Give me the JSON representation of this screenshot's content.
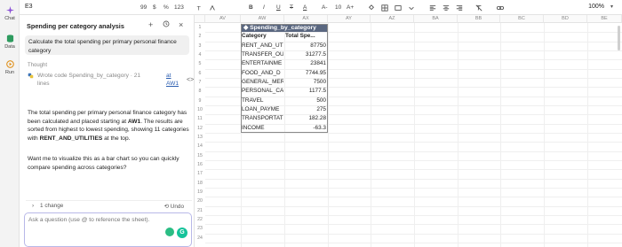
{
  "toolbar": {
    "cell_ref": "E3",
    "zoom": "100%",
    "font_size": "10",
    "decimals": "123",
    "percent": "%",
    "currency": "$",
    "quote": "99"
  },
  "rail": {
    "items": [
      {
        "label": "Chat"
      },
      {
        "label": "Data"
      },
      {
        "label": "Run"
      }
    ]
  },
  "panel": {
    "title": "Spending per category analysis",
    "user_message": "Calculate the total spending per primary personal finance category",
    "thought_label": "Thought",
    "tool_text": "Wrote code Spending_by_category · 21 lines",
    "tool_link": "at AW1",
    "answer_p1_a": "The total spending per primary personal finance category has been calculated and placed starting at ",
    "answer_p1_b": "AW1",
    "answer_p1_c": ". The results are sorted from highest to lowest spending, showing 11 categories with ",
    "answer_p1_d": "RENT_AND_UTILITIES",
    "answer_p1_e": " at the top.",
    "answer_p2": "Want me to visualize this as a bar chart so you can quickly compare spending across categories?",
    "change_label": "1 change",
    "undo_label": "Undo",
    "input_placeholder": "Ask a question (use @ to reference the sheet)."
  },
  "grid": {
    "columns": [
      "AV",
      "AW",
      "AX",
      "AY",
      "AZ",
      "BA",
      "BB",
      "BC",
      "BD",
      "BE"
    ],
    "rows": [
      "1",
      "2",
      "3",
      "4",
      "5",
      "6",
      "7",
      "8",
      "9",
      "10",
      "11",
      "12",
      "13",
      "14",
      "15",
      "16",
      "17",
      "18",
      "19",
      "20",
      "21",
      "22",
      "23",
      "24"
    ],
    "table_title": "Spending_by_category",
    "header": [
      "Category",
      "Total Spe..."
    ],
    "records": [
      [
        "RENT_AND_UTI",
        "87750"
      ],
      [
        "TRANSFER_OU",
        "31277.5"
      ],
      [
        "ENTERTAINME",
        "23841"
      ],
      [
        "FOOD_AND_D",
        "7744.95"
      ],
      [
        "GENERAL_MER",
        "7500"
      ],
      [
        "PERSONAL_CA",
        "1177.5"
      ],
      [
        "TRAVEL",
        "500"
      ],
      [
        "LOAN_PAYME",
        "275"
      ],
      [
        "TRANSPORTAT",
        "182.28"
      ],
      [
        "INCOME",
        "-63.3"
      ]
    ]
  }
}
